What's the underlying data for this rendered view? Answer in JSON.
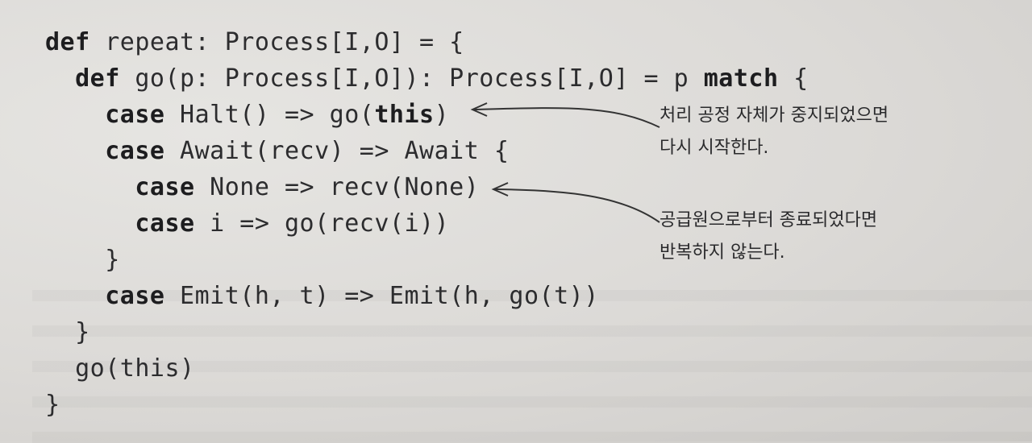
{
  "code_lines": [
    {
      "indent": "",
      "segments": [
        {
          "text": "def",
          "kw": true
        },
        {
          "text": " repeat: Process[I,O] = {",
          "kw": false
        }
      ]
    },
    {
      "indent": "  ",
      "segments": [
        {
          "text": "def",
          "kw": true
        },
        {
          "text": " go(p: Process[I,O]): Process[I,O] = p ",
          "kw": false
        },
        {
          "text": "match",
          "kw": true
        },
        {
          "text": " {",
          "kw": false
        }
      ]
    },
    {
      "indent": "    ",
      "segments": [
        {
          "text": "case",
          "kw": true
        },
        {
          "text": " Halt() => go(",
          "kw": false
        },
        {
          "text": "this",
          "kw": true
        },
        {
          "text": ")",
          "kw": false
        }
      ]
    },
    {
      "indent": "    ",
      "segments": [
        {
          "text": "case",
          "kw": true
        },
        {
          "text": " Await(recv) => Await {",
          "kw": false
        }
      ]
    },
    {
      "indent": "      ",
      "segments": [
        {
          "text": "case",
          "kw": true
        },
        {
          "text": " None => recv(None)",
          "kw": false
        }
      ]
    },
    {
      "indent": "      ",
      "segments": [
        {
          "text": "case",
          "kw": true
        },
        {
          "text": " i => go(recv(i))",
          "kw": false
        }
      ]
    },
    {
      "indent": "    ",
      "segments": [
        {
          "text": "}",
          "kw": false
        }
      ]
    },
    {
      "indent": "    ",
      "segments": [
        {
          "text": "case",
          "kw": true
        },
        {
          "text": " Emit(h, t) => Emit(h, go(t))",
          "kw": false
        }
      ]
    },
    {
      "indent": "  ",
      "segments": [
        {
          "text": "}",
          "kw": false
        }
      ]
    },
    {
      "indent": "  ",
      "segments": [
        {
          "text": "go(this)",
          "kw": false
        }
      ]
    },
    {
      "indent": "",
      "segments": [
        {
          "text": "}",
          "kw": false
        }
      ]
    }
  ],
  "annotations": {
    "halt_note": {
      "line1": "처리 공정 자체가 중지되었으면",
      "line2": "다시 시작한다."
    },
    "none_note": {
      "line1": "공급원으로부터 종료되었다면",
      "line2": "반복하지 않는다."
    }
  }
}
